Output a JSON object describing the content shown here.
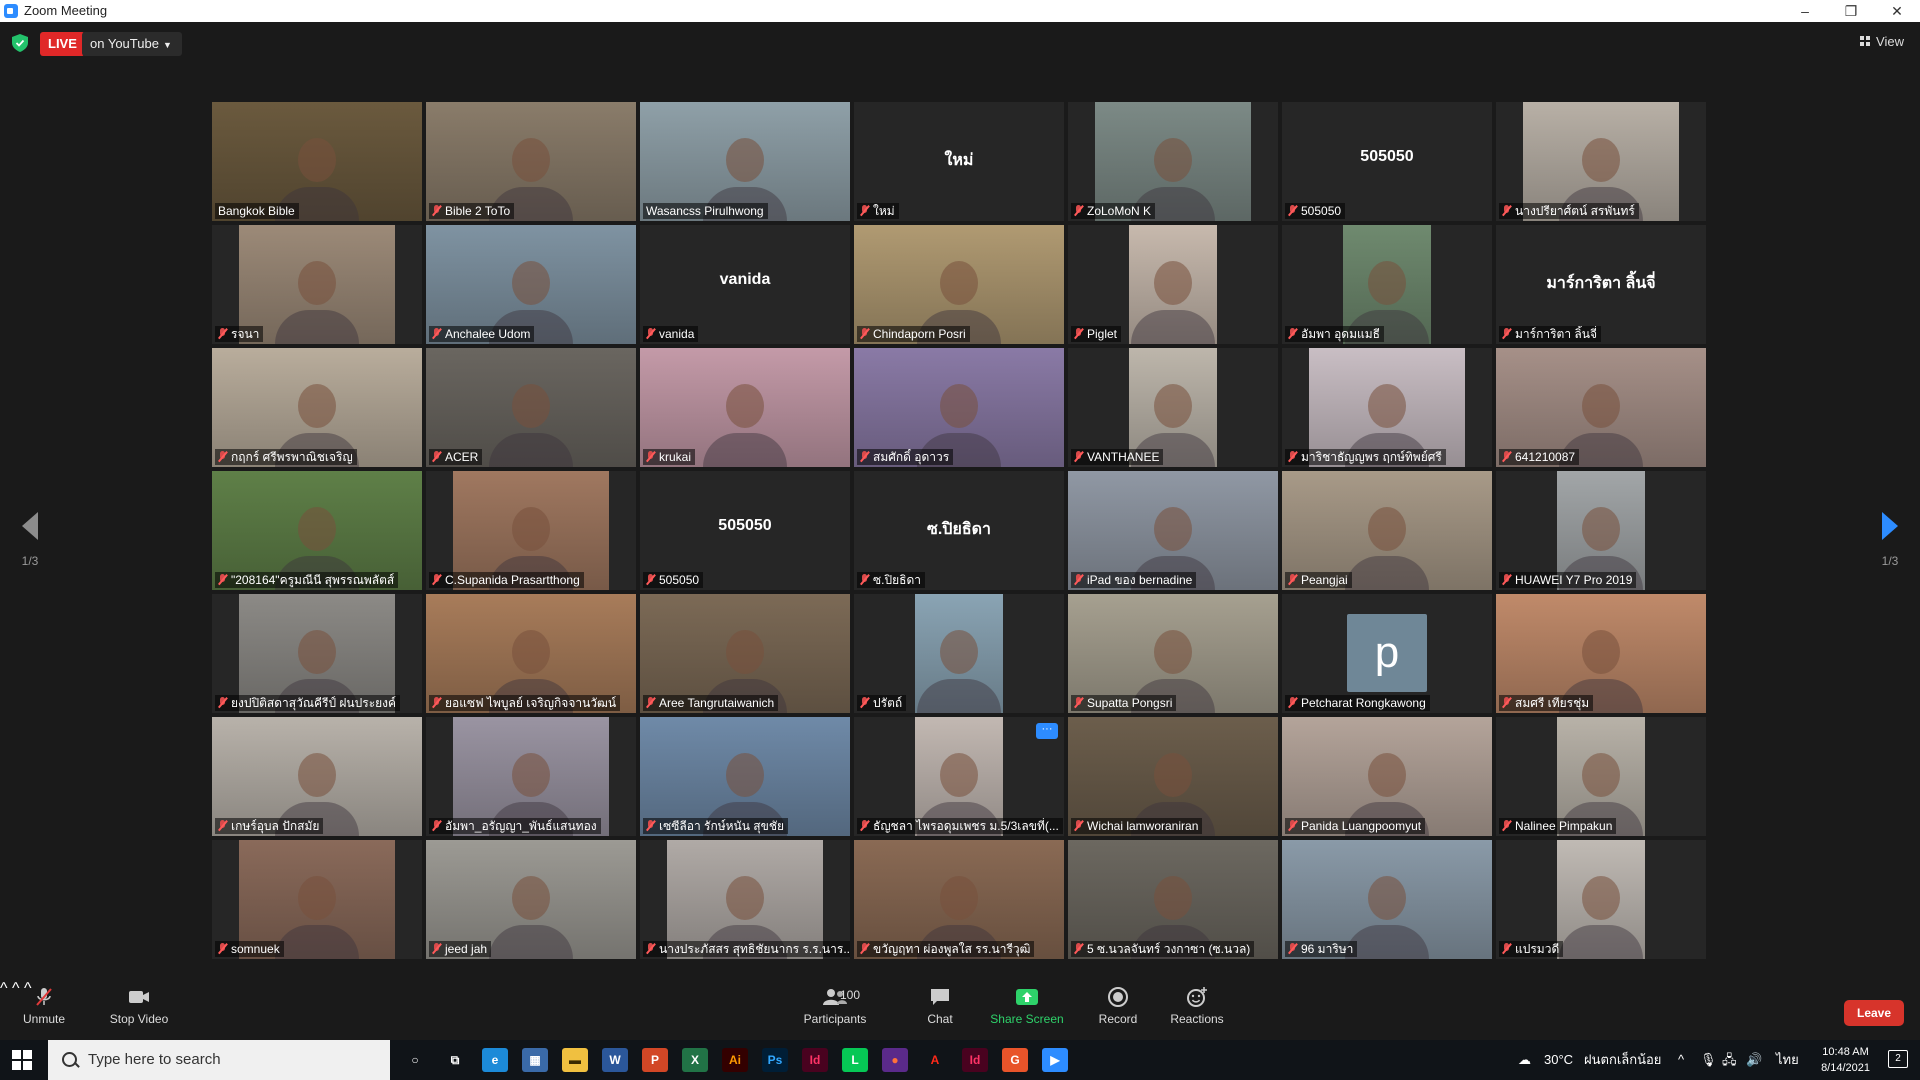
{
  "window": {
    "title": "Zoom Meeting",
    "minimize": "–",
    "restore": "❐",
    "close": "✕"
  },
  "header": {
    "live_label": "LIVE",
    "live_target": "on YouTube",
    "view_label": "View"
  },
  "pager": {
    "left": "1/3",
    "right": "1/3"
  },
  "participants": [
    {
      "name": "Bangkok Bible",
      "type": "video",
      "muted": false,
      "active": true,
      "bg": "#6b5a3e"
    },
    {
      "name": "Bible 2 ToTo",
      "type": "video",
      "muted": true,
      "bg": "#8a7c6a"
    },
    {
      "name": "Wasancss Pirulhwong",
      "type": "video",
      "muted": false,
      "bg": "#8fa0a8"
    },
    {
      "name": "ใหม่",
      "type": "name",
      "muted": true,
      "big": "ใหม่"
    },
    {
      "name": "ZoLoMoN K",
      "type": "video",
      "muted": true,
      "bg": "#7c8a86",
      "width": "narrow"
    },
    {
      "name": "505050",
      "type": "name",
      "muted": true,
      "big": "505050"
    },
    {
      "name": "นางปรียาศ์ตน์ สรพันทร์",
      "type": "video",
      "muted": true,
      "bg": "#b8b0a6",
      "width": "narrow"
    },
    {
      "name": "รจนา",
      "type": "video",
      "muted": true,
      "bg": "#9c8a78",
      "width": "narrow"
    },
    {
      "name": "Anchalee Udom",
      "type": "video",
      "muted": true,
      "bg": "#7f93a2"
    },
    {
      "name": "vanida",
      "type": "name",
      "muted": true,
      "big": "vanida"
    },
    {
      "name": "Chindaporn Posri",
      "type": "video",
      "muted": true,
      "bg": "#b09a72"
    },
    {
      "name": "Piglet",
      "type": "video",
      "muted": true,
      "bg": "#c7b9ad",
      "width": "vnarrow"
    },
    {
      "name": "อัมพา อุดมแมธี",
      "type": "video",
      "muted": true,
      "bg": "#6f8a6f",
      "width": "vnarrow"
    },
    {
      "name": "มาร์การิตา ลิ้นจี่",
      "type": "name",
      "muted": true,
      "big": "มาร์การิตา ลิ้นจี่"
    },
    {
      "name": "กฤกร์ ศรีพรพาณิชเจริญ",
      "type": "video",
      "muted": true,
      "bg": "#b9ad9c"
    },
    {
      "name": "ACER",
      "type": "video",
      "muted": true,
      "bg": "#6a6660"
    },
    {
      "name": "krukai",
      "type": "video",
      "muted": true,
      "bg": "#c49aa8"
    },
    {
      "name": "สมศักดิ์ อุดาวร",
      "type": "video",
      "muted": true,
      "bg": "#8a7aa6"
    },
    {
      "name": "VANTHANEE",
      "type": "video",
      "muted": true,
      "bg": "#bdb6ab",
      "width": "vnarrow"
    },
    {
      "name": "มาริชาธัญญพร ฤกษ์ทิพย์ศรี",
      "type": "video",
      "muted": true,
      "bg": "#c9bec4",
      "width": "narrow"
    },
    {
      "name": "641210087",
      "type": "video",
      "muted": true,
      "bg": "#a69088"
    },
    {
      "name": "\"208164\"ครูมณีนี สุพรรณพลัตส์",
      "type": "video",
      "muted": true,
      "bg": "#5f8048"
    },
    {
      "name": "C.Supanida Prasartthong",
      "type": "video",
      "muted": true,
      "bg": "#a07860",
      "width": "narrow"
    },
    {
      "name": "505050",
      "type": "name",
      "muted": true,
      "big": "505050"
    },
    {
      "name": "ซ.ปิยธิดา",
      "type": "name",
      "muted": true,
      "big": "ซ.ปิยธิดา"
    },
    {
      "name": "iPad ของ bernadine",
      "type": "video",
      "muted": true,
      "bg": "#9098a4"
    },
    {
      "name": "Peangjai",
      "type": "video",
      "muted": true,
      "bg": "#a89a88"
    },
    {
      "name": "HUAWEI Y7 Pro 2019",
      "type": "video",
      "muted": true,
      "bg": "#a2a6a8",
      "width": "vnarrow"
    },
    {
      "name": "ยงปปิติสดาสุวัณคีรีป์ ฝนประยงค์",
      "type": "video",
      "muted": true,
      "bg": "#8c8a86",
      "width": "narrow"
    },
    {
      "name": "ยอแซฟ ไพบูลย์ เจริญกิจจานวัฒน์",
      "type": "video",
      "muted": true,
      "bg": "#a87c5a"
    },
    {
      "name": "Aree Tangrutaiwanich",
      "type": "video",
      "muted": true,
      "bg": "#7c6a56"
    },
    {
      "name": "ปรัตถ์",
      "type": "video",
      "muted": true,
      "bg": "#8aa4b4",
      "width": "vnarrow"
    },
    {
      "name": "Supatta Pongsri",
      "type": "video",
      "muted": true,
      "bg": "#a6a090"
    },
    {
      "name": "Petcharat Rongkawong",
      "type": "avatar",
      "muted": true,
      "initial": "p"
    },
    {
      "name": "สมศรี เทียรชุ่ม",
      "type": "video",
      "muted": true,
      "bg": "#c08a6a"
    },
    {
      "name": "เกษร์อุบล ปักสมัย",
      "type": "video",
      "muted": true,
      "bg": "#b8b2aa"
    },
    {
      "name": "อัมพา_อรัญญา_พันธ์แสนทอง",
      "type": "video",
      "muted": true,
      "bg": "#9a94a2",
      "width": "narrow"
    },
    {
      "name": "เซซีลีอา รักษ์หนัน สุขชัย",
      "type": "video",
      "muted": true,
      "bg": "#6f8aa8"
    },
    {
      "name": "ธัญชลา ไพรอดุมเพชร ม.5/3เลขที่(...",
      "type": "video",
      "muted": true,
      "bg": "#c2b8b2",
      "width": "vnarrow",
      "more": true
    },
    {
      "name": "Wichai lamworaniran",
      "type": "video",
      "muted": true,
      "bg": "#6c5e4c"
    },
    {
      "name": "Panida Luangpoomyut",
      "type": "video",
      "muted": true,
      "bg": "#b4a49a"
    },
    {
      "name": "Nalinee Pimpakun",
      "type": "video",
      "muted": true,
      "bg": "#b8b2a8",
      "width": "vnarrow"
    },
    {
      "name": "somnuek",
      "type": "video",
      "muted": true,
      "bg": "#8a6a5a",
      "width": "narrow"
    },
    {
      "name": "jeed jah",
      "type": "video",
      "muted": true,
      "bg": "#9c9a94"
    },
    {
      "name": "นางประภัสสร สุทธิชัยนากร ร.ร.นาร...",
      "type": "video",
      "muted": true,
      "bg": "#b0aaa6",
      "width": "narrow"
    },
    {
      "name": "ขวัญฤทา ผ่องพูลใส รร.นารีวุฒิ",
      "type": "video",
      "muted": true,
      "bg": "#8a6a54"
    },
    {
      "name": "5 ซ.นวลจันทร์ วงกาซา (ซ.นวล)",
      "type": "video",
      "muted": true,
      "bg": "#6c6860"
    },
    {
      "name": "96 มาริษา",
      "type": "video",
      "muted": true,
      "bg": "#8a9aa8"
    },
    {
      "name": "แปรมวดี",
      "type": "video",
      "muted": true,
      "bg": "#c0bab4",
      "width": "vnarrow"
    }
  ],
  "toolbar": {
    "unmute": "Unmute",
    "stop_video": "Stop Video",
    "participants": "Participants",
    "participant_count": "100",
    "chat": "Chat",
    "share_screen": "Share Screen",
    "record": "Record",
    "reactions": "Reactions",
    "leave": "Leave"
  },
  "taskbar": {
    "search_placeholder": "Type here to search",
    "weather": "30°C",
    "weather_desc": "ฝนตกเล็กน้อย",
    "lang": "ไทย",
    "time": "10:48 AM",
    "date": "8/14/2021",
    "notifications": "2",
    "apps": [
      {
        "name": "cortana-icon",
        "glyph": "○",
        "color": "#ffffff",
        "bg": "transparent"
      },
      {
        "name": "task-view-icon",
        "glyph": "⧉",
        "color": "#ffffff",
        "bg": "transparent"
      },
      {
        "name": "edge-icon",
        "glyph": "e",
        "color": "#ffffff",
        "bg": "#1c8ad8"
      },
      {
        "name": "calculator-icon",
        "glyph": "▦",
        "color": "#ffffff",
        "bg": "#3a6aa8"
      },
      {
        "name": "file-explorer-icon",
        "glyph": "▬",
        "color": "#3a2a00",
        "bg": "#f0c040"
      },
      {
        "name": "word-icon",
        "glyph": "W",
        "color": "#ffffff",
        "bg": "#2b579a"
      },
      {
        "name": "powerpoint-icon",
        "glyph": "P",
        "color": "#ffffff",
        "bg": "#d24726"
      },
      {
        "name": "excel-icon",
        "glyph": "X",
        "color": "#ffffff",
        "bg": "#217346"
      },
      {
        "name": "illustrator-icon",
        "glyph": "Ai",
        "color": "#ff9a00",
        "bg": "#330000"
      },
      {
        "name": "photoshop-icon",
        "glyph": "Ps",
        "color": "#31a8ff",
        "bg": "#001e36"
      },
      {
        "name": "indesign-icon",
        "glyph": "Id",
        "color": "#ff3366",
        "bg": "#49021f"
      },
      {
        "name": "line-icon",
        "glyph": "L",
        "color": "#ffffff",
        "bg": "#06c755"
      },
      {
        "name": "firefox-icon",
        "glyph": "●",
        "color": "#ff7139",
        "bg": "#5a2a8a"
      },
      {
        "name": "acrobat-icon",
        "glyph": "A",
        "color": "#ff2a1a",
        "bg": "transparent"
      },
      {
        "name": "indesign-2-icon",
        "glyph": "Id",
        "color": "#ff3366",
        "bg": "#49021f"
      },
      {
        "name": "grammarly-icon",
        "glyph": "G",
        "color": "#ffffff",
        "bg": "#e8542a"
      },
      {
        "name": "zoom-icon",
        "glyph": "▶",
        "color": "#ffffff",
        "bg": "#2d8cff"
      }
    ]
  }
}
